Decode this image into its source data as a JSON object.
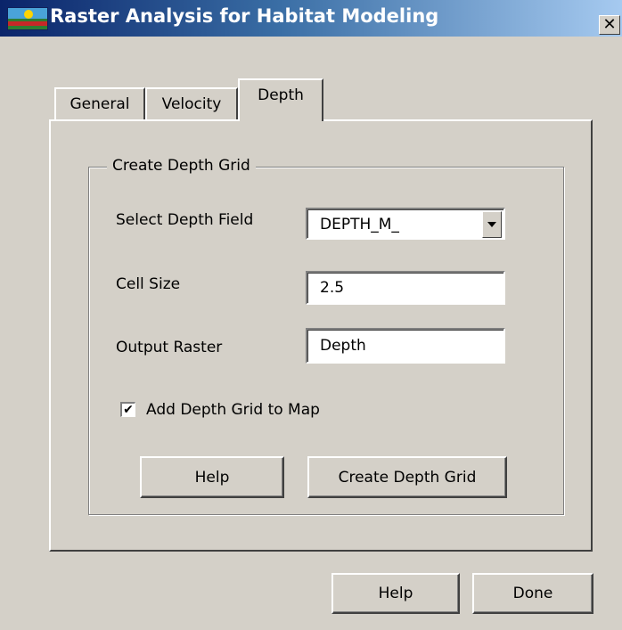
{
  "window": {
    "title": "Raster Analysis for Habitat Modeling",
    "close_glyph": "✕"
  },
  "tabs": [
    {
      "label": "General",
      "selected": false
    },
    {
      "label": "Velocity",
      "selected": false
    },
    {
      "label": "Depth",
      "selected": true
    }
  ],
  "group": {
    "legend": "Create Depth Grid",
    "depth_field": {
      "label": "Select Depth Field",
      "value": "DEPTH_M_"
    },
    "cell_size": {
      "label": "Cell Size",
      "value": "2.5"
    },
    "output_raster": {
      "label": "Output Raster",
      "value": "Depth"
    },
    "add_to_map": {
      "label": "Add Depth Grid to Map",
      "checked": true,
      "glyph": "✔"
    },
    "help_label": "Help",
    "create_label": "Create Depth Grid"
  },
  "footer": {
    "help_label": "Help",
    "done_label": "Done"
  },
  "icons": {
    "app": "habitat-map-icon",
    "dropdown": "chevron-down-icon",
    "close": "close-icon"
  },
  "colors": {
    "face": "#d4d0c8",
    "title_start": "#0a246a",
    "title_end": "#a6caf0"
  }
}
